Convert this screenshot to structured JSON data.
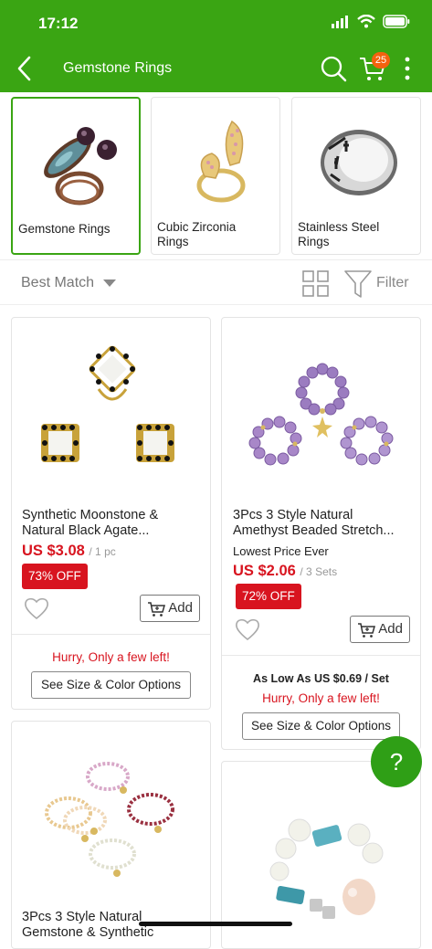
{
  "status": {
    "time": "17:12"
  },
  "header": {
    "title": "Gemstone Rings",
    "cart_count": "25"
  },
  "categories": [
    {
      "label": "Gemstone Rings"
    },
    {
      "label": "Cubic Zirconia Rings"
    },
    {
      "label": "Stainless Steel Rings"
    }
  ],
  "sort": {
    "label": "Best Match",
    "filter_label": "Filter"
  },
  "products": [
    {
      "title": "Synthetic Moonstone & Natural Black Agate...",
      "price": "US $3.08",
      "unit": "/ 1 pc",
      "discount": "73% OFF",
      "add_label": "Add",
      "stock_note": "Hurry, Only a few left!",
      "options_label": "See Size & Color Options"
    },
    {
      "title": "3Pcs 3 Style Natural Amethyst Beaded Stretch...",
      "tagline": "Lowest Price Ever",
      "price": "US $2.06",
      "unit": "/ 3 Sets",
      "discount": "72% OFF",
      "add_label": "Add",
      "as_low_as": "As Low As US $0.69 / Set",
      "stock_note": "Hurry, Only a few left!",
      "options_label": "See Size & Color Options"
    },
    {
      "title": "3Pcs 3 Style Natural Gemstone & Synthetic"
    },
    {
      "title": ""
    }
  ],
  "help": {
    "label": "?"
  },
  "colors": {
    "brand_green": "#3aa513",
    "price_red": "#d8141f",
    "badge_orange": "#f3620f"
  }
}
